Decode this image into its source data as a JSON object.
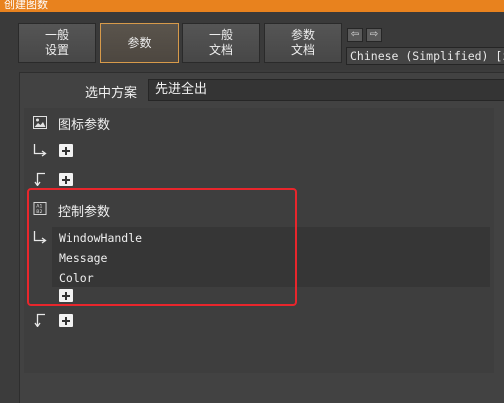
{
  "window": {
    "title": "创建图数"
  },
  "tabs": [
    {
      "label": "一般\n设置",
      "active": false
    },
    {
      "label": "参数",
      "active": true
    },
    {
      "label": "一般\n文档",
      "active": false
    },
    {
      "label": "参数\n文档",
      "active": false
    }
  ],
  "nav": {
    "back": "⇦",
    "forward": "⇨"
  },
  "language": {
    "value": "Chinese (Simplified) [zh"
  },
  "scheme": {
    "label": "选中方案",
    "value": "先进全出"
  },
  "icon_section": {
    "title": "图标参数",
    "icon": "image-icon"
  },
  "control_section": {
    "title": "控制参数",
    "icon": "ab-box-icon",
    "params": [
      "WindowHandle",
      "Message",
      "Color"
    ]
  },
  "colors": {
    "accent": "#e8821e",
    "highlight": "#e8262c",
    "active_tab_border": "#d79a4a"
  }
}
